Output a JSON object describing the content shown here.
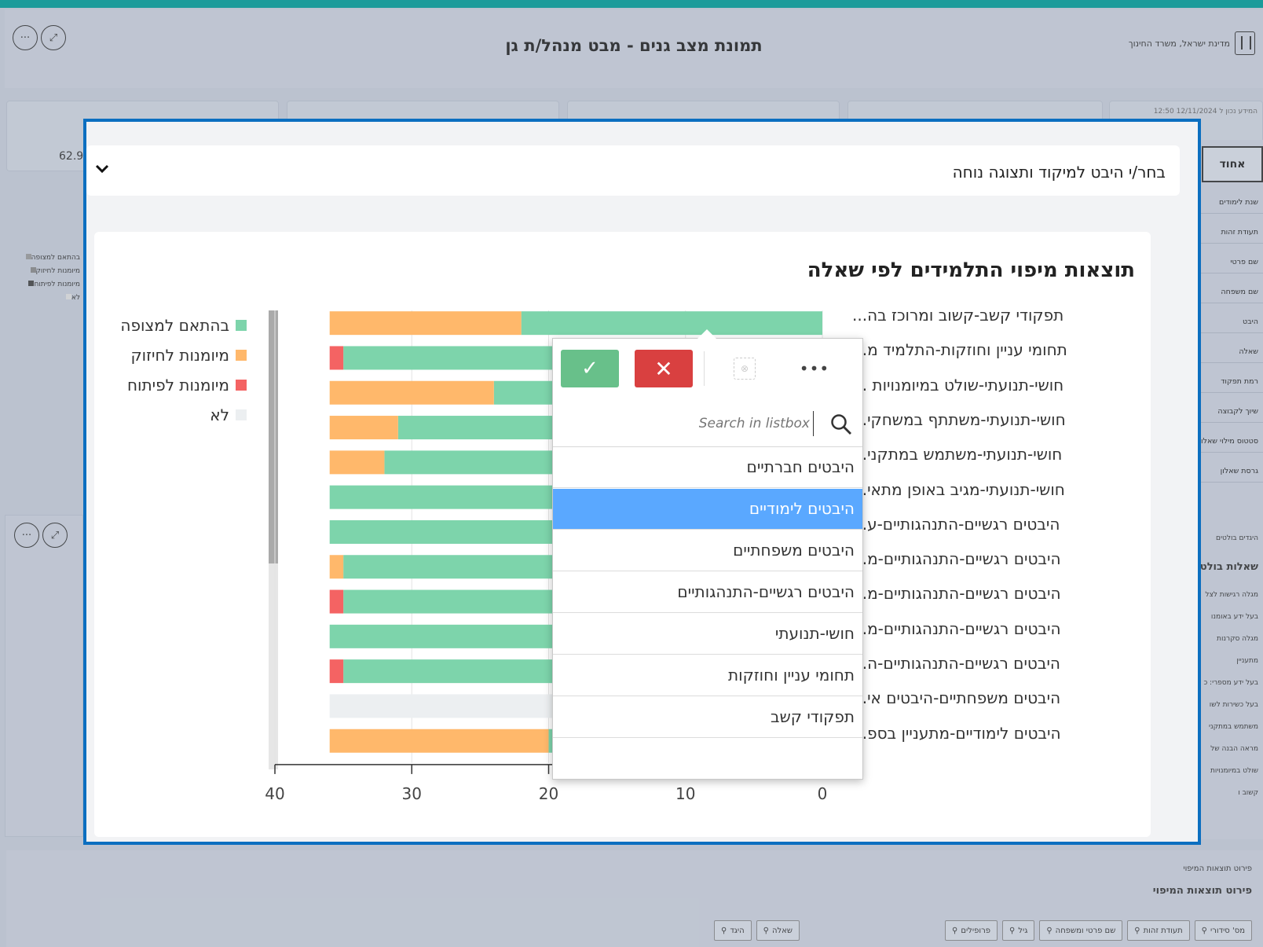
{
  "app": {
    "title": "תמונת מצב גנים - מבט מנהל/ת גן",
    "org": "מדינת ישראל, משרד החינוך",
    "updated_label": "המידע נכון ל",
    "updated_value": "12/11/2024 12:50",
    "kpi_value": "62.9"
  },
  "sidebar": {
    "one_button": "אחוד",
    "items": [
      "שנת לימודים",
      "תעודת זהות",
      "שם פרטי",
      "שם משפחה",
      "היבט",
      "שאלה",
      "רמת תפקוד",
      "שיוך לקבוצה",
      "סטטוס מילוי שאלון",
      "גרסת שאלון"
    ],
    "section_heading": "היגדים בולטים",
    "bold_heading": "שאלות בולטות",
    "lines": [
      "מגלה רגישות לצל",
      "בעל ידע באומנו",
      "מגלה סקרנות",
      "מתעניין",
      "בעל ידע מספרי: כ",
      "בעל כשירות לשו",
      "משתמש במתקני",
      "מראה הבנה של",
      "שולט במיומנויות",
      "קשוב ו"
    ]
  },
  "bg_legend": [
    "בהתאם למצופה",
    "מיומנות לחיזוק",
    "מיומנות לפיתוח",
    "לא"
  ],
  "bottom": {
    "title_small": "פירוט תוצאות המיפוי",
    "title_bold": "פירוט תוצאות המיפוי",
    "filters_right": [
      "מס' סידורי",
      "תעודת זהות",
      "שם פרטי ומשפחה",
      "גיל",
      "פרופילים"
    ],
    "filters_left": [
      "שאלה",
      "היגד"
    ]
  },
  "modal": {
    "selector_label": "בחר/י היבט למיקוד ותצוגה נוחה",
    "listbox": {
      "search_placeholder": "Search in listbox",
      "items": [
        "היבטים חברתיים",
        "היבטים לימודיים",
        "היבטים משפחתיים",
        "היבטים רגשיים-התנהגותיים",
        "חושי-תנועתי",
        "תחומי עניין וחוזקות",
        "תפקודי קשב"
      ],
      "selected_index": 1
    }
  },
  "colors": {
    "match": "#7dd4ab",
    "strengthen": "#ffb86b",
    "develop": "#f46363",
    "no": "#eceff1",
    "accent": "#0c6fc0",
    "topbar": "#009a95"
  },
  "chart_data": {
    "type": "bar",
    "orientation": "horizontal-stacked",
    "title": "תוצאות מיפוי התלמידים לפי שאלה",
    "xlim": [
      0,
      40
    ],
    "xticks": [
      0,
      10,
      20,
      30,
      40
    ],
    "legend_position": "left",
    "grid": true,
    "categories": [
      "תפקודי קשב-קשוב ומרוכז בה...",
      "תחומי עניין וחוזקות-התלמיד מ...",
      "חושי-תנועתי-שולט במיומנויות ...",
      "חושי-תנועתי-משתתף במשחקי...",
      "חושי-תנועתי-משתמש במתקני...",
      "חושי-תנועתי-מגיב באופן מתאי...",
      "היבטים רגשיים-התנהגותיים-ע...",
      "היבטים רגשיים-התנהגותיים-מ...",
      "היבטים רגשיים-התנהגותיים-מ...",
      "היבטים רגשיים-התנהגותיים-מ...",
      "היבטים רגשיים-התנהגותיים-ה...",
      "היבטים משפחתיים-היבטים אי...",
      "היבטים לימודיים-מתעניין בספ..."
    ],
    "series": [
      {
        "name": "בהתאם למצופה",
        "color": "#7dd4ab",
        "values": [
          22,
          35,
          24,
          31,
          32,
          36,
          36,
          35,
          35,
          36,
          35,
          0,
          20
        ]
      },
      {
        "name": "מיומנות לפיתוח",
        "color": "#f46363",
        "values": [
          0,
          1,
          0,
          0,
          0,
          0,
          0,
          0,
          1,
          0,
          1,
          0,
          0
        ]
      },
      {
        "name": "מיומנות לחיזוק",
        "color": "#ffb86b",
        "values": [
          14,
          0,
          12,
          5,
          4,
          0,
          0,
          1,
          0,
          0,
          0,
          0,
          16
        ]
      },
      {
        "name": "לא",
        "color": "#eceff1",
        "values": [
          0,
          0,
          0,
          0,
          0,
          0,
          0,
          0,
          0,
          0,
          0,
          36,
          0
        ]
      }
    ]
  }
}
